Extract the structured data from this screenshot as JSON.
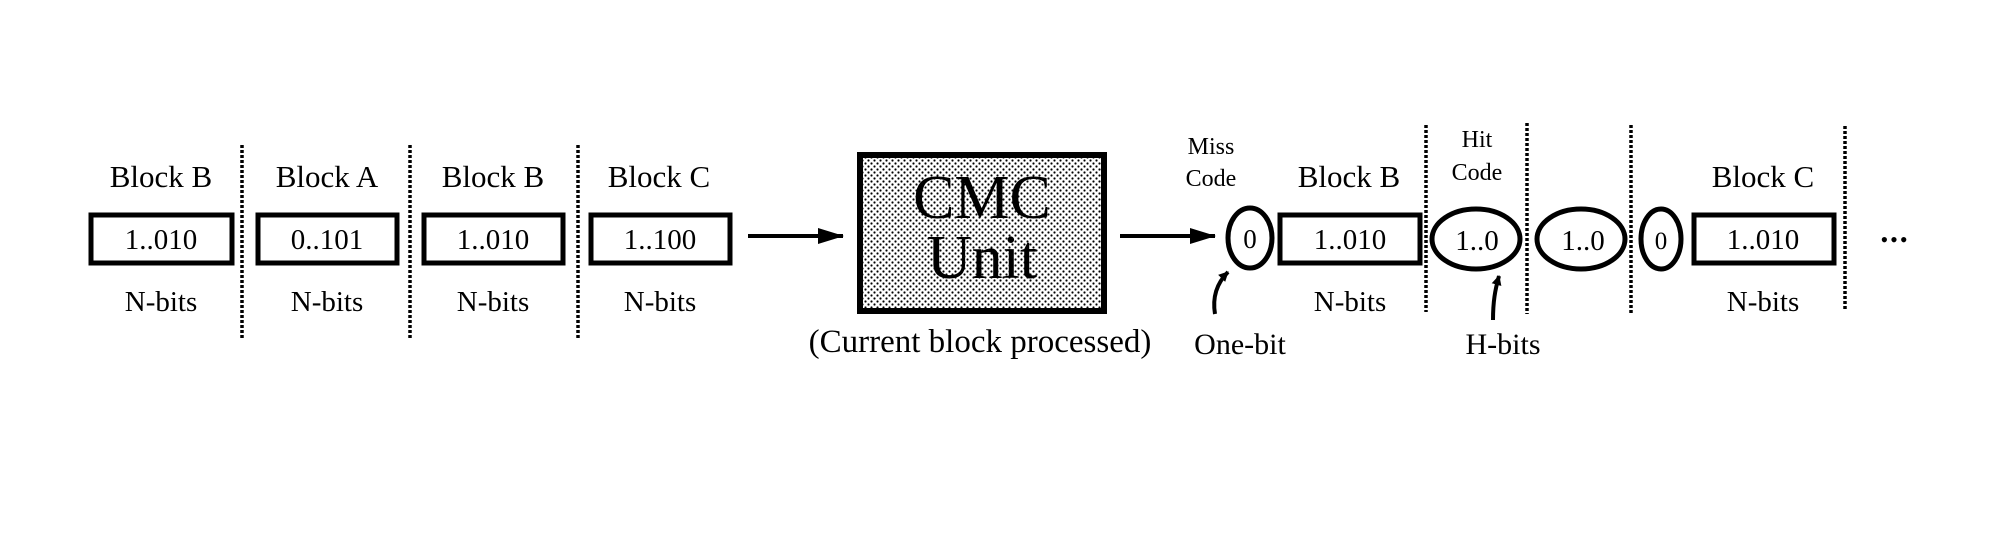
{
  "input_stream": {
    "blocks": [
      {
        "name": "Block B",
        "value": "1..010",
        "size": "N-bits"
      },
      {
        "name": "Block A",
        "value": "0..101",
        "size": "N-bits"
      },
      {
        "name": "Block B",
        "value": "1..010",
        "size": "N-bits"
      },
      {
        "name": "Block C",
        "value": "1..100",
        "size": "N-bits"
      }
    ]
  },
  "cmc_unit": {
    "line1": "CMC",
    "line2": "Unit",
    "caption": "(Current block processed)"
  },
  "output_stream": {
    "miss_code_label_line1": "Miss",
    "miss_code_label_line2": "Code",
    "miss_code_value": "0",
    "block_b": {
      "name": "Block B",
      "value": "1..010",
      "size": "N-bits"
    },
    "one_bit_label": "One-bit",
    "hit_code_label_line1": "Hit",
    "hit_code_label_line2": "Code",
    "hit_code_value_1": "1..0",
    "hit_code_value_2": "1..0",
    "h_bits_label": "H-bits",
    "miss_code_value_2": "0",
    "block_c": {
      "name": "Block C",
      "value": "1..010",
      "size": "N-bits"
    },
    "ellipsis": "•••"
  },
  "colors": {
    "stroke": "#000000",
    "fill_pattern_bg": "#ffffff",
    "fill_pattern_dot": "#000000"
  }
}
